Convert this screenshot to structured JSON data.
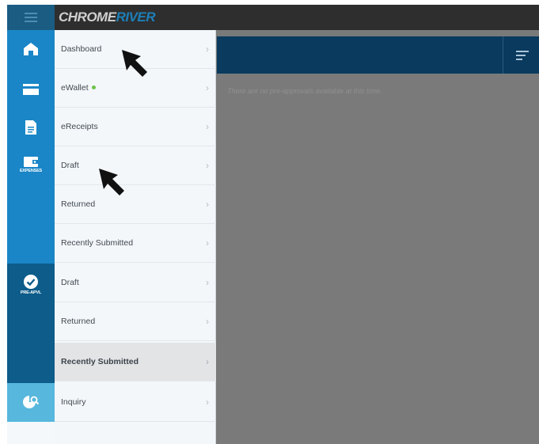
{
  "app": {
    "logo_part1": "CHROME",
    "logo_part2": "RIVER",
    "brand_color": "#1d7fb8"
  },
  "main": {
    "empty_message": "There are no pre-approvals available at this time."
  },
  "rail": {
    "expenses_label": "EXPENSES",
    "preapproval_label": "PRE-APVL"
  },
  "menu": {
    "items": [
      {
        "label": "Dashboard"
      },
      {
        "label": "eWallet",
        "status_dot_color": "#6cc24a"
      },
      {
        "label": "eReceipts"
      },
      {
        "label": "Draft"
      },
      {
        "label": "Returned"
      },
      {
        "label": "Recently Submitted"
      },
      {
        "label": "Draft"
      },
      {
        "label": "Returned"
      },
      {
        "label": "Recently Submitted",
        "selected": true
      },
      {
        "label": "Inquiry"
      }
    ],
    "chevron": "›"
  }
}
